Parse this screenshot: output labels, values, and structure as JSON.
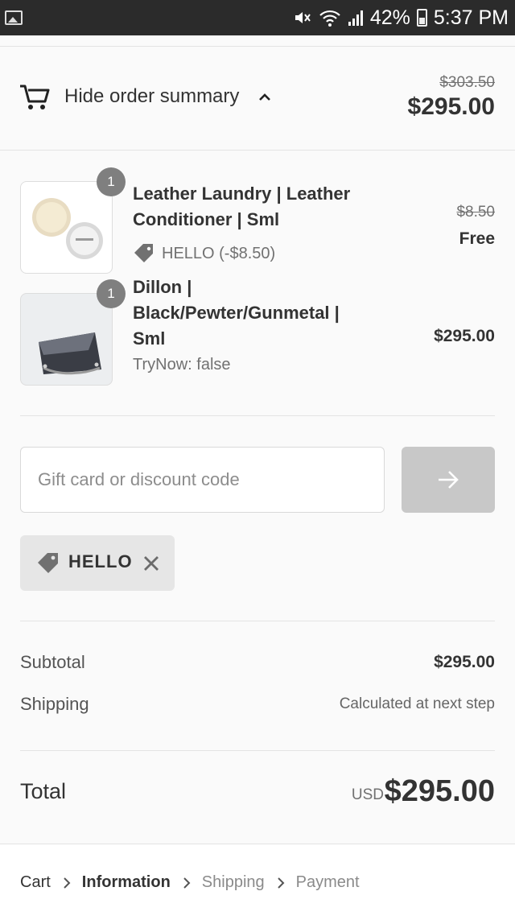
{
  "status_bar": {
    "battery": "42%",
    "time": "5:37 PM"
  },
  "summary": {
    "toggle_label": "Hide order summary",
    "old_total": "$303.50",
    "total": "$295.00"
  },
  "items": [
    {
      "quantity": "1",
      "name": "Leather Laundry | Leather Conditioner | Sml",
      "discount": "HELLO (-$8.50)",
      "old_price": "$8.50",
      "price": "Free"
    },
    {
      "quantity": "1",
      "name": "Dillon | Black/Pewter/Gunmetal | Sml",
      "property": "TryNow: false",
      "price": "$295.00"
    }
  ],
  "discount_form": {
    "placeholder": "Gift card or discount code",
    "applied_code": "HELLO"
  },
  "totals": {
    "subtotal_label": "Subtotal",
    "subtotal_value": "$295.00",
    "shipping_label": "Shipping",
    "shipping_value": "Calculated at next step",
    "total_label": "Total",
    "currency": "USD",
    "total_value": "$295.00"
  },
  "breadcrumb": [
    "Cart",
    "Information",
    "Shipping",
    "Payment"
  ],
  "colors": {
    "status_bar": "#2b2b2b",
    "badge": "#7f7f7f",
    "apply_button": "#c8c8c8",
    "chip": "#e6e6e6"
  }
}
